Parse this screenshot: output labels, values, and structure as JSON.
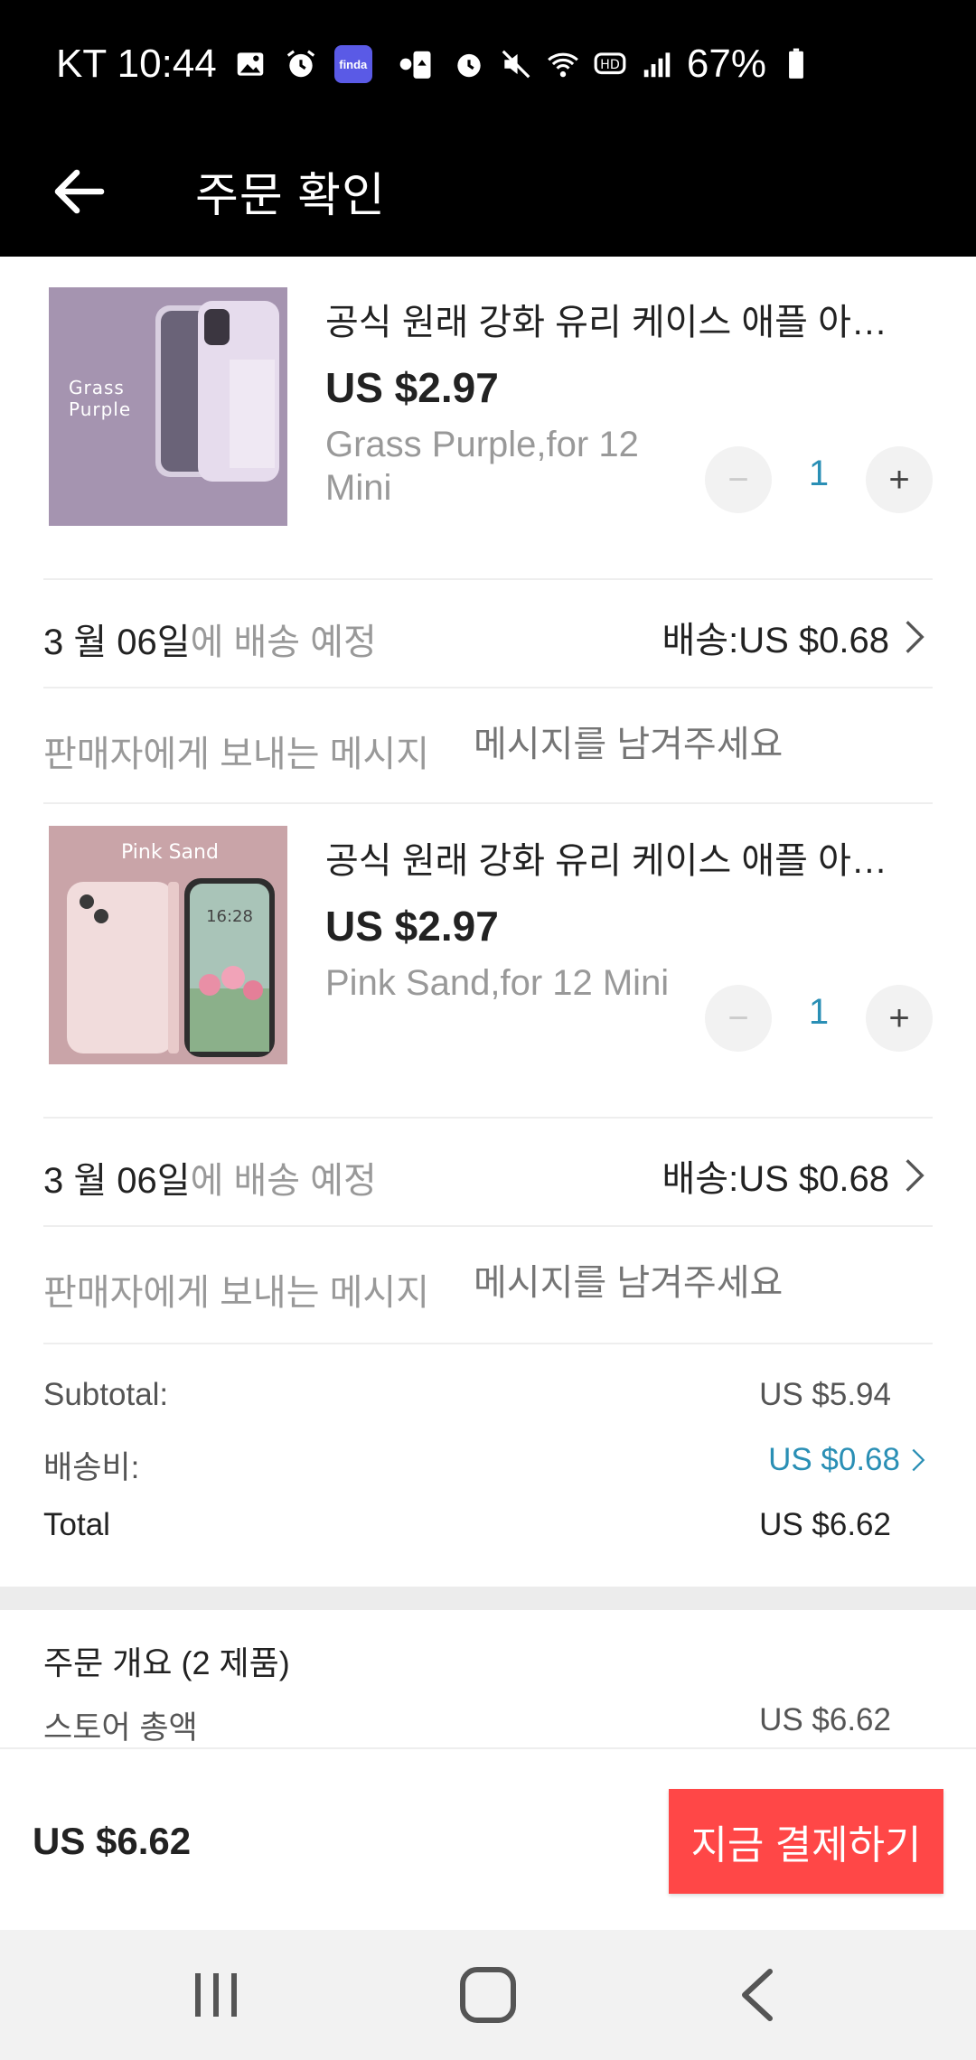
{
  "status_bar": {
    "carrier_time": "KT 10:44",
    "battery": "67%",
    "finda_label": "finda"
  },
  "header": {
    "title": "주문 확인"
  },
  "items": [
    {
      "name": "공식 원래 강화 유리 케이스 애플 아이...",
      "price": "US $2.97",
      "variant": "Grass Purple,for 12 Mini",
      "quantity": "1",
      "thumb_text": "Grass\nPurple",
      "thumb_color": "#a594b0",
      "ship_date": "3 월 06일",
      "ship_suffix": "에 배송 예정",
      "ship_cost": "배송:US $0.68",
      "msg_label": "판매자에게 보내는 메시지",
      "msg_placeholder": "메시지를 남겨주세요"
    },
    {
      "name": "공식 원래 강화 유리 케이스 애플 아이...",
      "price": "US $2.97",
      "variant": "Pink Sand,for 12 Mini",
      "quantity": "1",
      "thumb_text": "Pink Sand",
      "thumb_time": "16:28",
      "thumb_color": "#c9a4a8",
      "ship_date": "3 월 06일",
      "ship_suffix": "에 배송 예정",
      "ship_cost": "배송:US $0.68",
      "msg_label": "판매자에게 보내는 메시지",
      "msg_placeholder": "메시지를 남겨주세요"
    }
  ],
  "summary": {
    "subtotal_label": "Subtotal:",
    "subtotal_value": "US $5.94",
    "shipping_label": "배송비:",
    "shipping_value": "US $0.68",
    "total_label": "Total",
    "total_value": "US $6.62"
  },
  "overview": {
    "title": "주문 개요 (2 제품)",
    "store_total_label": "스토어 총액",
    "store_total_value": "US $6.62"
  },
  "pay_bar": {
    "total": "US $6.62",
    "button_label": "지금 결제하기"
  },
  "colors": {
    "accent_red": "#ff4747",
    "link_blue": "#2a8fb5",
    "header_bg": "#000000"
  }
}
